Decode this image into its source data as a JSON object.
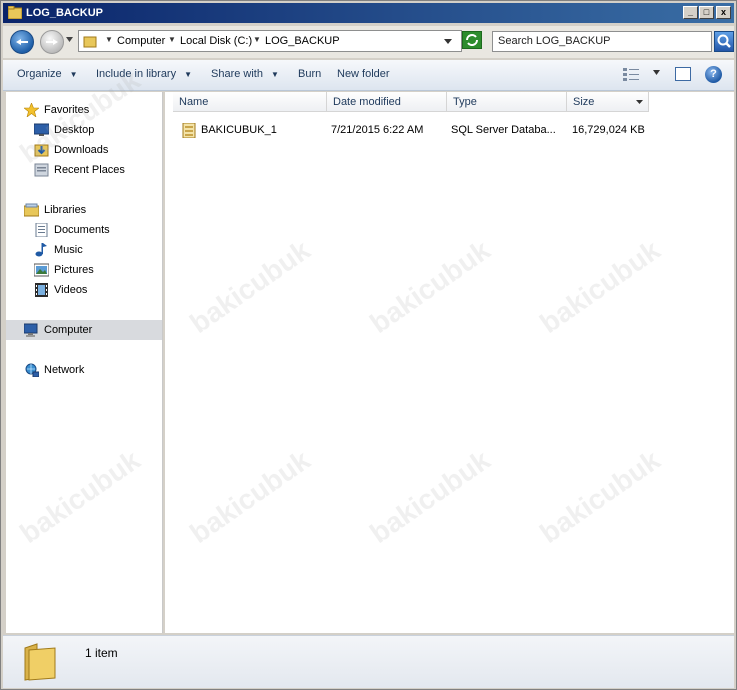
{
  "window": {
    "title": "LOG_BACKUP",
    "controls": {
      "minimize": "_",
      "maximize": "□",
      "close": "x"
    }
  },
  "address_bar": {
    "crumbs": [
      "Computer",
      "Local Disk (C:)",
      "LOG_BACKUP"
    ]
  },
  "search": {
    "placeholder": "Search LOG_BACKUP"
  },
  "toolbar": {
    "organize": "Organize",
    "include_in_library": "Include in library",
    "share_with": "Share with",
    "burn": "Burn",
    "new_folder": "New folder",
    "help": "?"
  },
  "nav_pane": {
    "favorites": "Favorites",
    "desktop": "Desktop",
    "downloads": "Downloads",
    "recent_places": "Recent Places",
    "libraries": "Libraries",
    "documents": "Documents",
    "music": "Music",
    "pictures": "Pictures",
    "videos": "Videos",
    "computer": "Computer",
    "network": "Network"
  },
  "file_list": {
    "columns": {
      "name": "Name",
      "date": "Date modified",
      "type": "Type",
      "size": "Size"
    },
    "rows": [
      {
        "name": "BAKICUBUK_1",
        "date": "7/21/2015 6:22 AM",
        "type": "SQL Server Databa...",
        "size": "16,729,024 KB"
      }
    ]
  },
  "details": {
    "item_count": "1 item"
  },
  "watermark": "bakicubuk",
  "colors": {
    "title_bar": "#0a246a",
    "selection": "#d8dade",
    "folder": "#e8c75a"
  }
}
